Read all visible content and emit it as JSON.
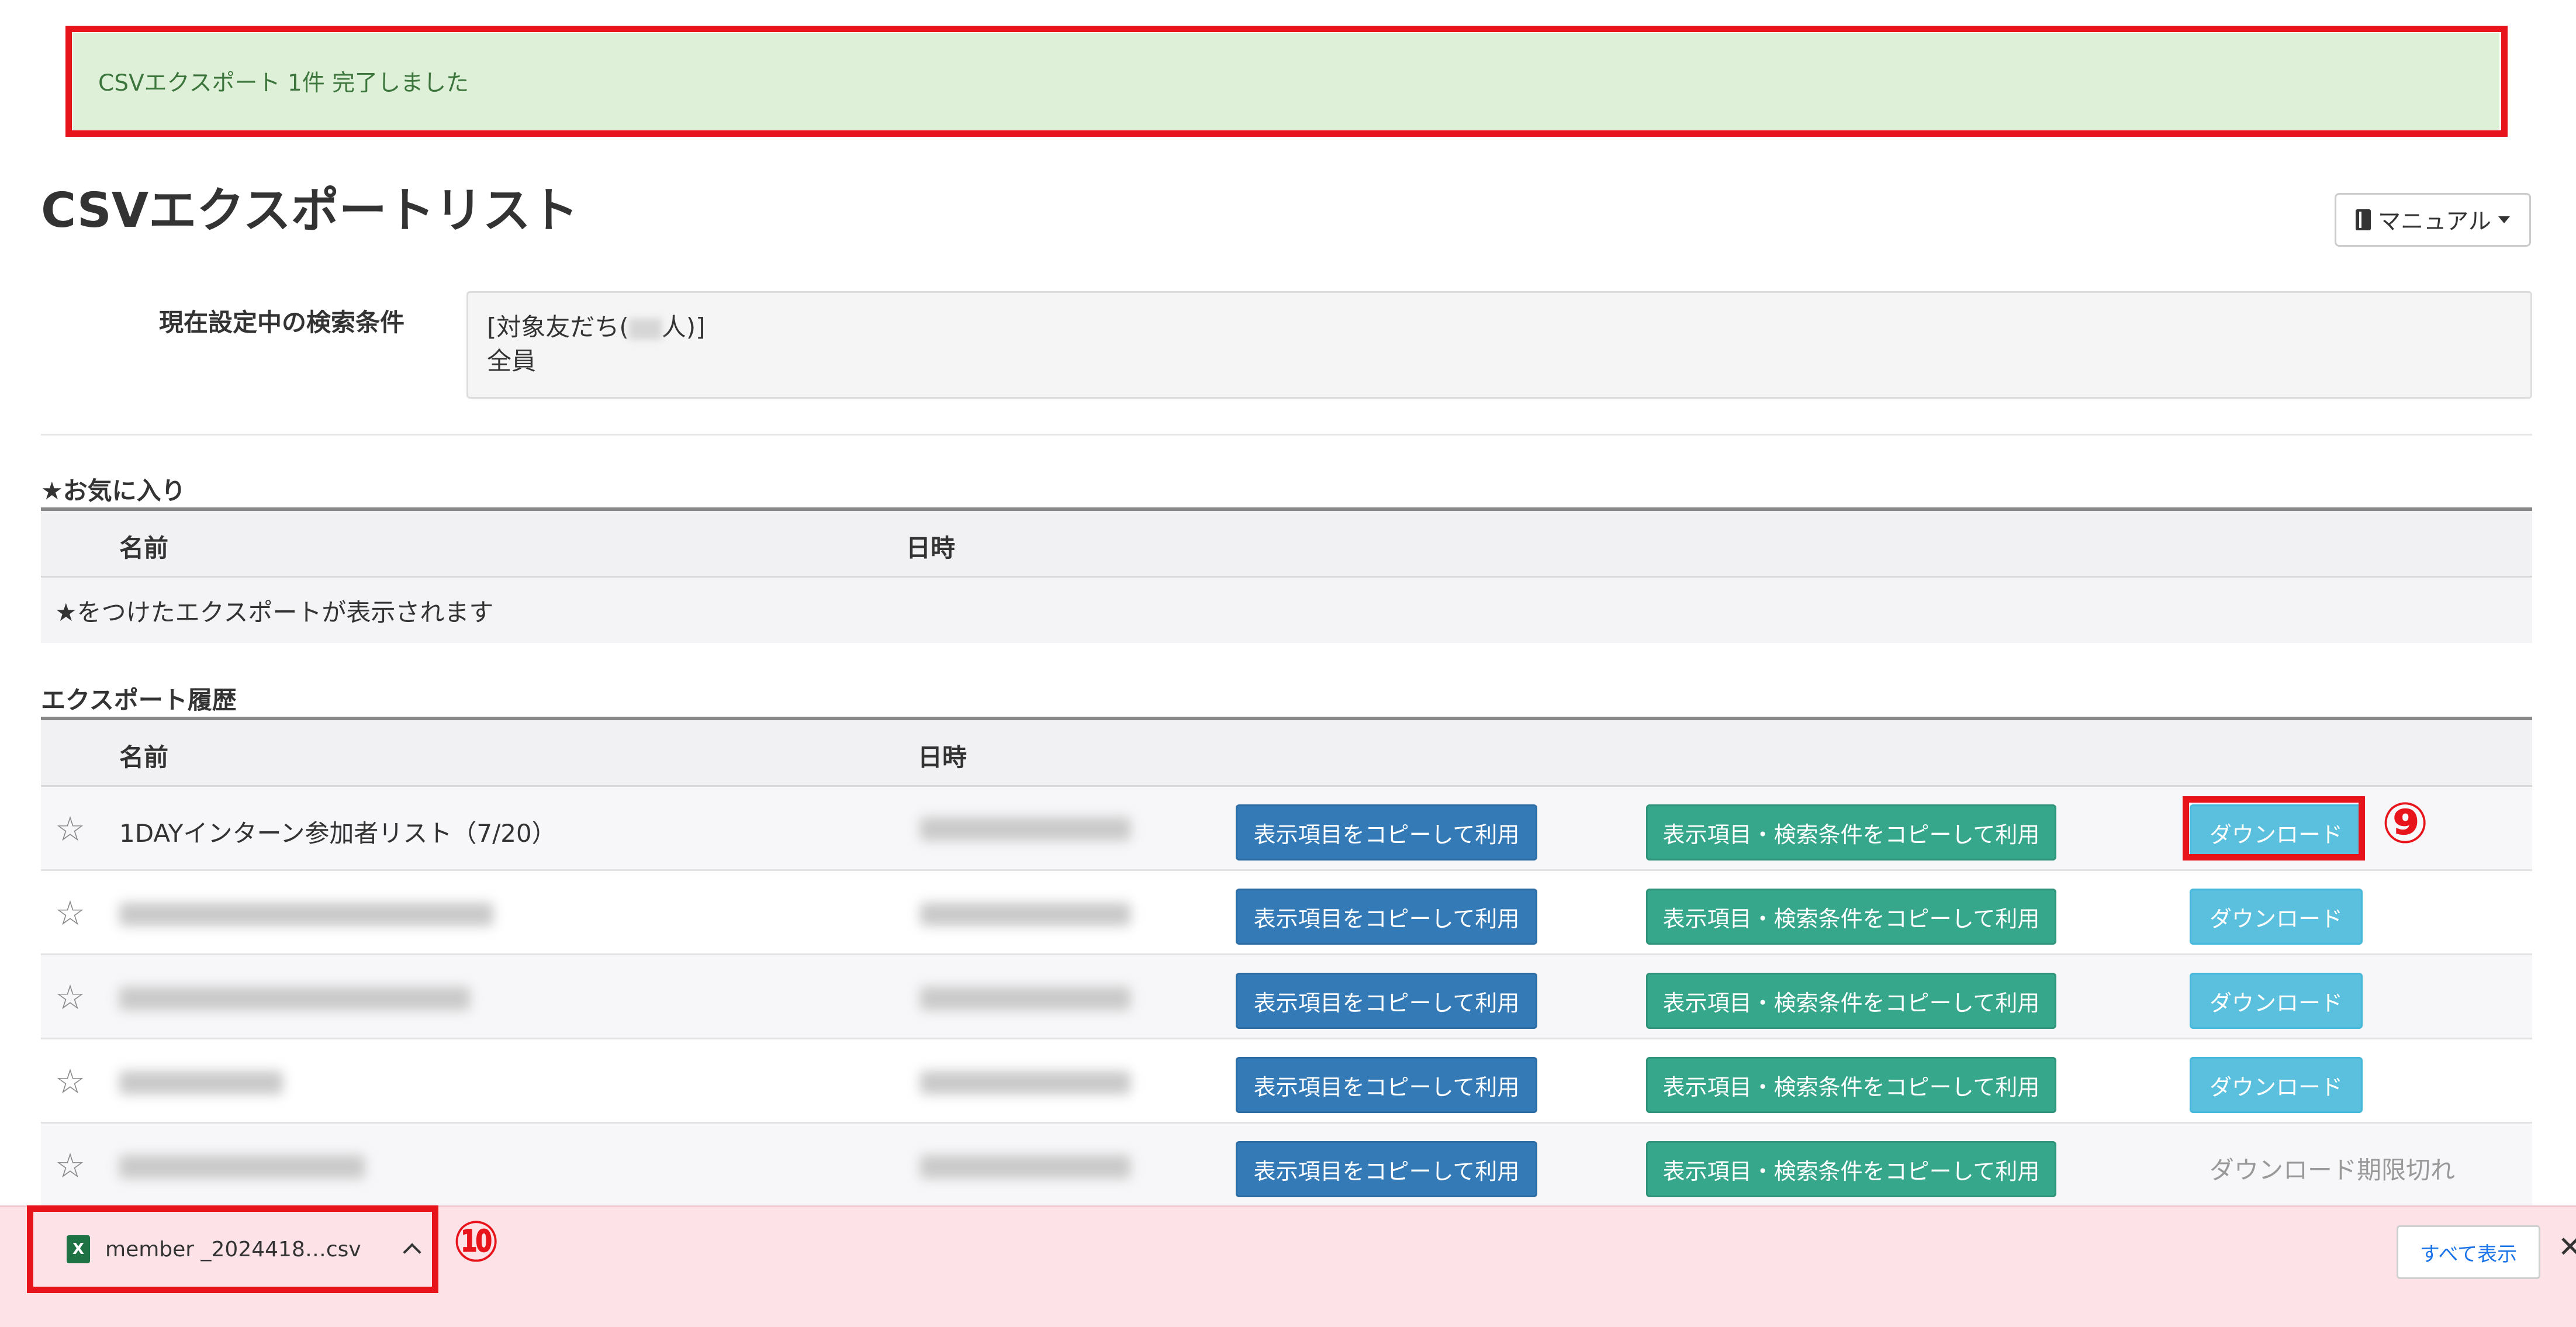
{
  "alert": {
    "message": "CSVエクスポート 1件 完了しました"
  },
  "page": {
    "title": "CSVエクスポートリスト",
    "manual_label": "マニュアル"
  },
  "condition": {
    "label": "現在設定中の検索条件",
    "line1_prefix": "[対象友だち(",
    "line1_suffix": "人)]",
    "line2": "全員"
  },
  "favorites": {
    "title": "★お気に入り",
    "columns": {
      "name": "名前",
      "date": "日時"
    },
    "empty_text": "★をつけたエクスポートが表示されます"
  },
  "history": {
    "title": "エクスポート履歴",
    "columns": {
      "name": "名前",
      "date": "日時"
    },
    "star": "☆",
    "copy_fields_label": "表示項目をコピーして利用",
    "copy_fields_conditions_label": "表示項目・検索条件をコピーして利用",
    "download_label": "ダウンロード",
    "expired_label": "ダウンロード期限切れ",
    "rows": [
      {
        "name": "1DAYインターン参加者リスト（7/20）"
      }
    ]
  },
  "markers": {
    "download": "⑨",
    "file": "⑩"
  },
  "download_bar": {
    "file_name": "member _2024418…csv",
    "file_icon": "excel-file-icon",
    "show_all_label": "すべて表示",
    "close_label": "✕"
  },
  "colors": {
    "alert_bg": "#dff0d8",
    "alert_text": "#3c763d",
    "highlight": "#e8141b",
    "btn_blue": "#337ab7",
    "btn_green": "#36a78b",
    "btn_download": "#5bc0de",
    "download_bar_bg": "#fde3e8"
  }
}
